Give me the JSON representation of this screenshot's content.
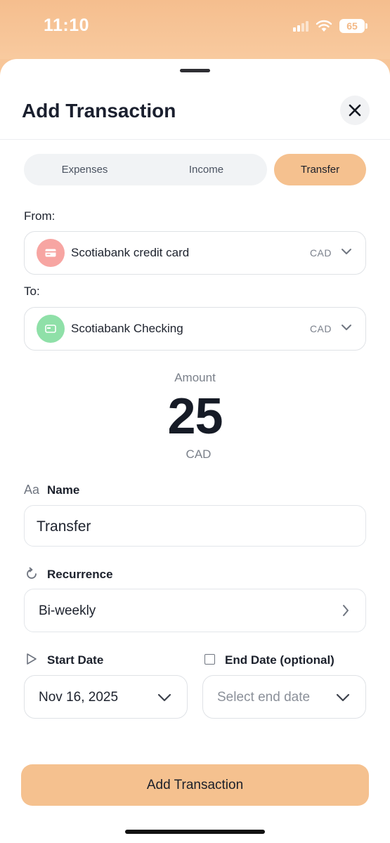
{
  "status_bar": {
    "time": "11:10",
    "battery": "65",
    "icons": [
      "signal-icon",
      "wifi-icon",
      "battery-icon"
    ]
  },
  "sheet": {
    "title": "Add Transaction",
    "close_icon": "close-icon"
  },
  "type_selector": {
    "options": [
      "Expenses",
      "Income",
      "Transfer"
    ],
    "selected": "Transfer"
  },
  "from": {
    "label": "From:",
    "account": "Scotiabank credit card",
    "currency": "CAD",
    "icon_color": "#f7a5a2"
  },
  "to": {
    "label": "To:",
    "account": "Scotiabank Checking",
    "currency": "CAD",
    "icon_color": "#8fe0a8"
  },
  "amount": {
    "label": "Amount",
    "value": "25",
    "currency": "CAD"
  },
  "name": {
    "icon_text": "Aa",
    "label": "Name",
    "value": "Transfer"
  },
  "recurrence": {
    "label": "Recurrence",
    "value": "Bi-weekly"
  },
  "start_date": {
    "label": "Start Date",
    "value": "Nov 16, 2025"
  },
  "end_date": {
    "label": "End Date (optional)",
    "placeholder": "Select end date",
    "checked": false
  },
  "submit": {
    "label": "Add Transaction"
  },
  "colors": {
    "accent": "#f5c18f",
    "header_bg": "#f7c699"
  }
}
